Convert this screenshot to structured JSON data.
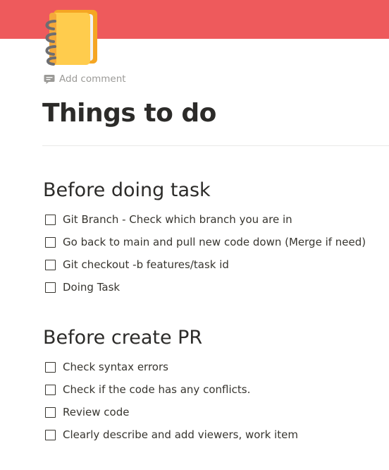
{
  "cover": {
    "color": "#ee5a5c"
  },
  "page": {
    "icon": "notebook-icon",
    "add_comment_label": "Add comment",
    "title": "Things to do"
  },
  "sections": [
    {
      "heading": "Before doing task",
      "todos": [
        {
          "text": "Git Branch - Check which branch you are in",
          "checked": false
        },
        {
          "text": "Go back to main and pull new code down (Merge if need)",
          "checked": false
        },
        {
          "text": "Git checkout -b features/task id",
          "checked": false
        },
        {
          "text": "Doing Task",
          "checked": false
        }
      ]
    },
    {
      "heading": "Before create PR",
      "todos": [
        {
          "text": "Check syntax errors",
          "checked": false
        },
        {
          "text": "Check if the code has any conflicts.",
          "checked": false
        },
        {
          "text": "Review code",
          "checked": false
        },
        {
          "text": "Clearly describe and add viewers, work item",
          "checked": false
        }
      ]
    }
  ]
}
